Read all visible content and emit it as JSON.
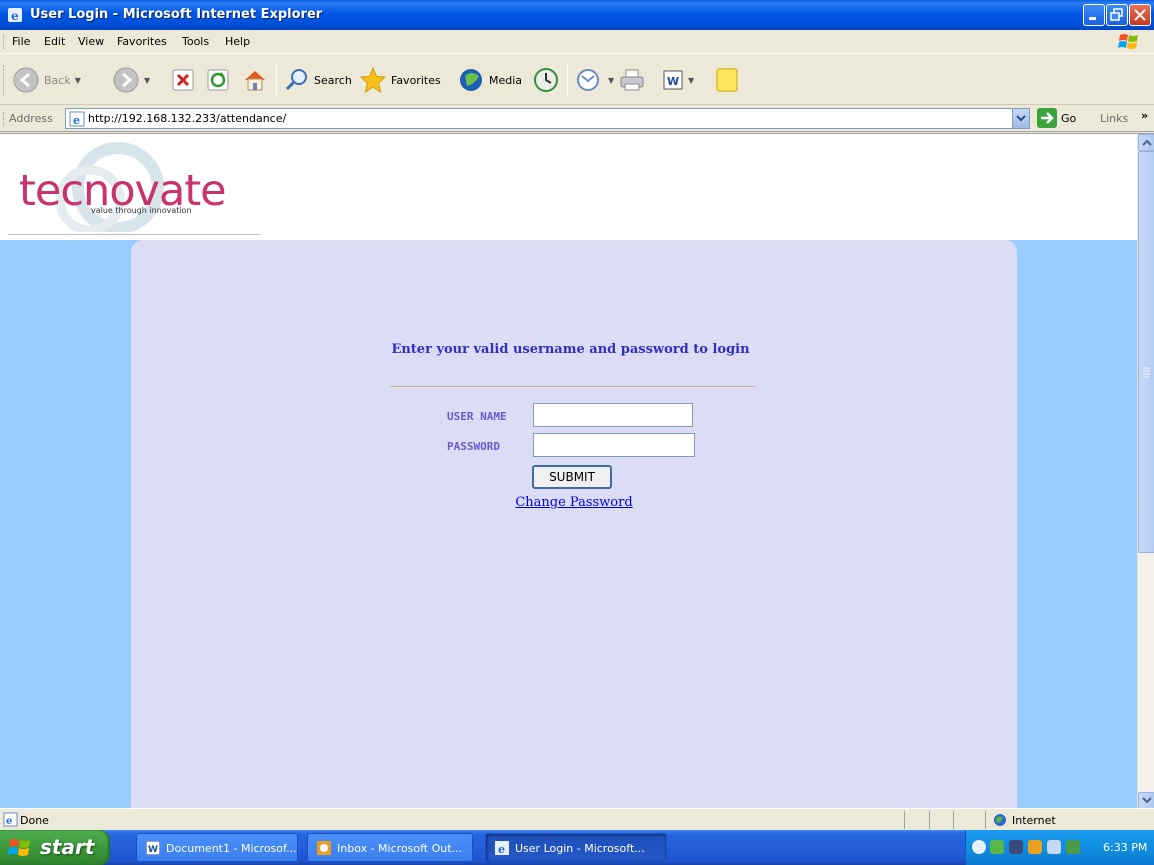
{
  "window": {
    "title": "User Login - Microsoft Internet Explorer"
  },
  "menu": {
    "items": [
      "File",
      "Edit",
      "View",
      "Favorites",
      "Tools",
      "Help"
    ]
  },
  "toolbar": {
    "back_label": "Back",
    "search_label": "Search",
    "favorites_label": "Favorites",
    "media_label": "Media"
  },
  "address": {
    "label": "Address",
    "url": "http://192.168.132.233/attendance/",
    "go_label": "Go",
    "links_label": "Links",
    "links_chevron": "»"
  },
  "page": {
    "logo_text": "tecnovate",
    "logo_tagline": "value through innovation",
    "heading": "Enter your valid username and password to login",
    "username_label": "USER NAME",
    "password_label": "PASSWORD",
    "username_value": "",
    "password_value": "",
    "submit_label": "SUBMIT",
    "change_password_link": "Change Password"
  },
  "status": {
    "text": "Done",
    "zone": "Internet"
  },
  "taskbar": {
    "start_label": "start",
    "tasks": [
      {
        "label": "Document1 - Microsof...",
        "icon": "word-icon"
      },
      {
        "label": "Inbox - Microsoft Out...",
        "icon": "outlook-icon"
      },
      {
        "label": "User Login - Microsoft...",
        "icon": "ie-icon"
      }
    ],
    "clock": "6:33 PM"
  },
  "colors": {
    "page_background": "#99CCFF",
    "panel_background": "#DCDCF5",
    "heading_color": "#2F2FC0",
    "label_color": "#6A5ACD",
    "logo_color": "#C8336E"
  }
}
